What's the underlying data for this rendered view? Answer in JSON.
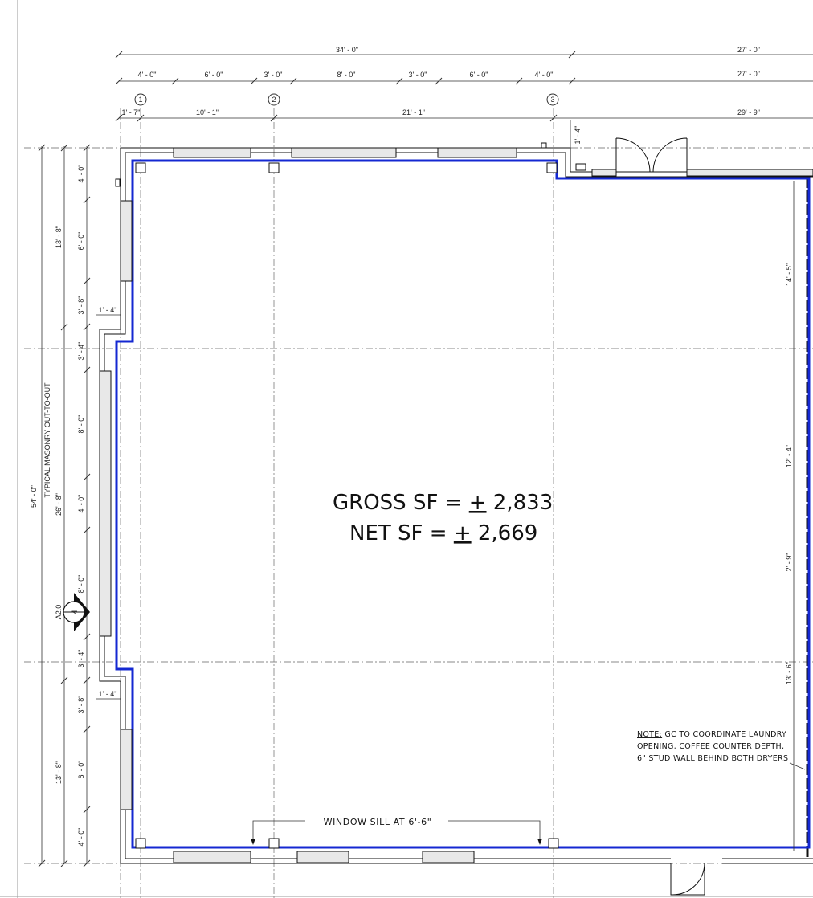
{
  "top_dimensions": {
    "overall_left": "34' - 0\"",
    "overall_right_1": "27' - 0\"",
    "overall_right_2": "27' - 0\"",
    "overall_right_3": "29' - 9\"",
    "segments": [
      "4' - 0\"",
      "6' - 0\"",
      "3' - 0\"",
      "8' - 0\"",
      "3' - 0\"",
      "6' - 0\"",
      "4' - 0\""
    ],
    "grid_offsets": [
      "1' - 7\"",
      "10' - 1\"",
      "21' - 1\""
    ],
    "grid_bubbles": [
      "1",
      "2",
      "3"
    ],
    "corner_jog": "1' - 4\""
  },
  "left_dimensions": {
    "overall": "54' - 0\"",
    "overall_note": "TYPICAL MASONRY OUT-TO-OUT",
    "upper_total": "13' - 8\"",
    "middle_total": "26' - 8\"",
    "lower_total": "13' - 8\"",
    "segments": [
      "4' - 0\"",
      "6' - 0\"",
      "3' - 8\"",
      "3' - 4\"",
      "8' - 0\"",
      "4' - 0\"",
      "8' - 0\"",
      "3' - 4\"",
      "3' - 8\"",
      "6' - 0\"",
      "4' - 0\""
    ],
    "jog_upper": "1' - 4\"",
    "jog_lower": "1' - 4\""
  },
  "section_marker": {
    "number": "4",
    "sheet": "A2.0"
  },
  "right_dimensions": [
    "14' - 5\"",
    "12' - 4\"",
    "2' - 9\"",
    "13' - 6\""
  ],
  "area": {
    "gross_label": "GROSS SF =",
    "gross_value": "2,833",
    "net_label": "NET SF =",
    "net_value": "2,669",
    "plus_minus": "+"
  },
  "note": {
    "prefix": "NOTE:",
    "line1": " GC TO COORDINATE LAUNDRY",
    "line2": "OPENING, COFFEE COUNTER DEPTH,",
    "line3": "6\" STUD WALL BEHIND BOTH DRYERS"
  },
  "window_sill": "WINDOW SILL AT 6'-6\""
}
